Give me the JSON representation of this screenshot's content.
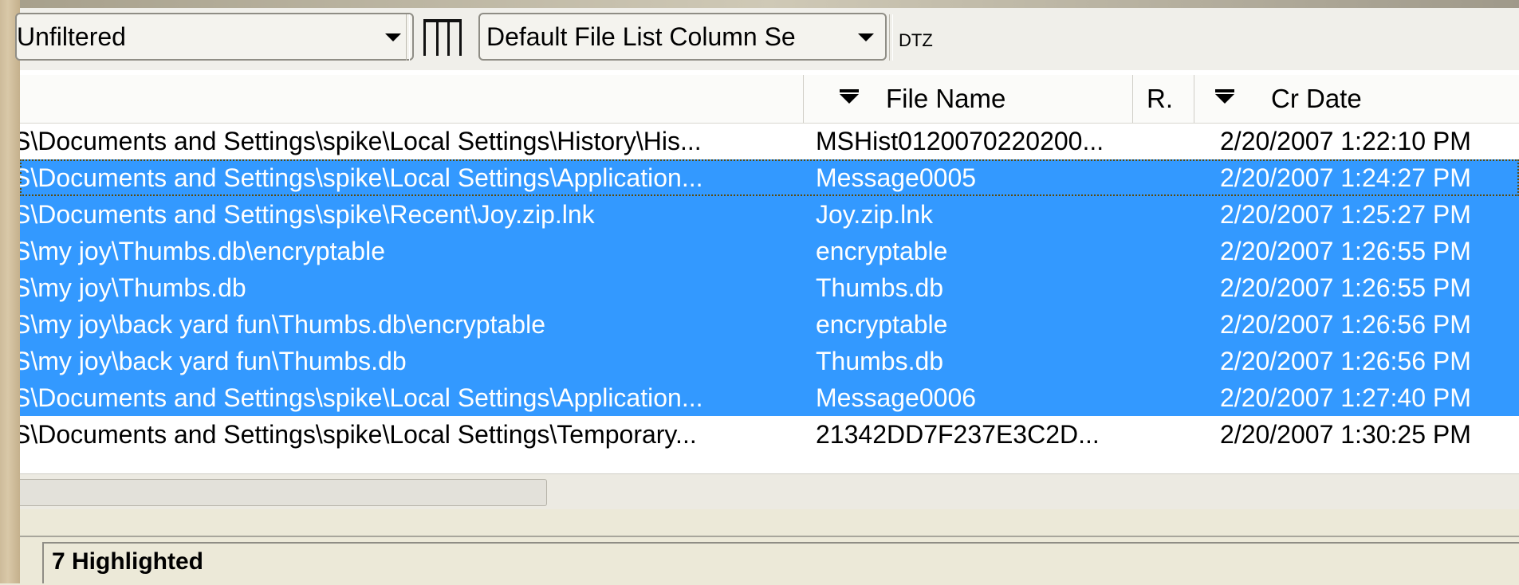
{
  "toolbar": {
    "filter_value": "Unfiltered",
    "column_set_value": "Default File List Column Se",
    "dtz_label": "DTZ"
  },
  "columns": {
    "path": "",
    "file_name": "File Name",
    "r": "R.",
    "cr_date": "Cr Date"
  },
  "rows": [
    {
      "path": "S\\Documents and Settings\\spike\\Local Settings\\History\\His...",
      "name": "MSHist0120070220200...",
      "date": "2/20/2007 1:22:10 PM",
      "selected": false
    },
    {
      "path": "S\\Documents and Settings\\spike\\Local Settings\\Application...",
      "name": "Message0005",
      "date": "2/20/2007 1:24:27 PM",
      "selected": true
    },
    {
      "path": "S\\Documents and Settings\\spike\\Recent\\Joy.zip.lnk",
      "name": "Joy.zip.lnk",
      "date": "2/20/2007 1:25:27 PM",
      "selected": true
    },
    {
      "path": "S\\my joy\\Thumbs.db\\encryptable",
      "name": "encryptable",
      "date": "2/20/2007 1:26:55 PM",
      "selected": true
    },
    {
      "path": "S\\my joy\\Thumbs.db",
      "name": "Thumbs.db",
      "date": "2/20/2007 1:26:55 PM",
      "selected": true
    },
    {
      "path": "S\\my joy\\back yard fun\\Thumbs.db\\encryptable",
      "name": "encryptable",
      "date": "2/20/2007 1:26:56 PM",
      "selected": true
    },
    {
      "path": "S\\my joy\\back yard fun\\Thumbs.db",
      "name": "Thumbs.db",
      "date": "2/20/2007 1:26:56 PM",
      "selected": true
    },
    {
      "path": "S\\Documents and Settings\\spike\\Local Settings\\Application...",
      "name": "Message0006",
      "date": "2/20/2007 1:27:40 PM",
      "selected": true
    },
    {
      "path": "S\\Documents and Settings\\spike\\Local Settings\\Temporary...",
      "name": "21342DD7F237E3C2D...",
      "date": "2/20/2007 1:30:25 PM",
      "selected": false
    }
  ],
  "status": {
    "highlighted": "7 Highlighted"
  }
}
